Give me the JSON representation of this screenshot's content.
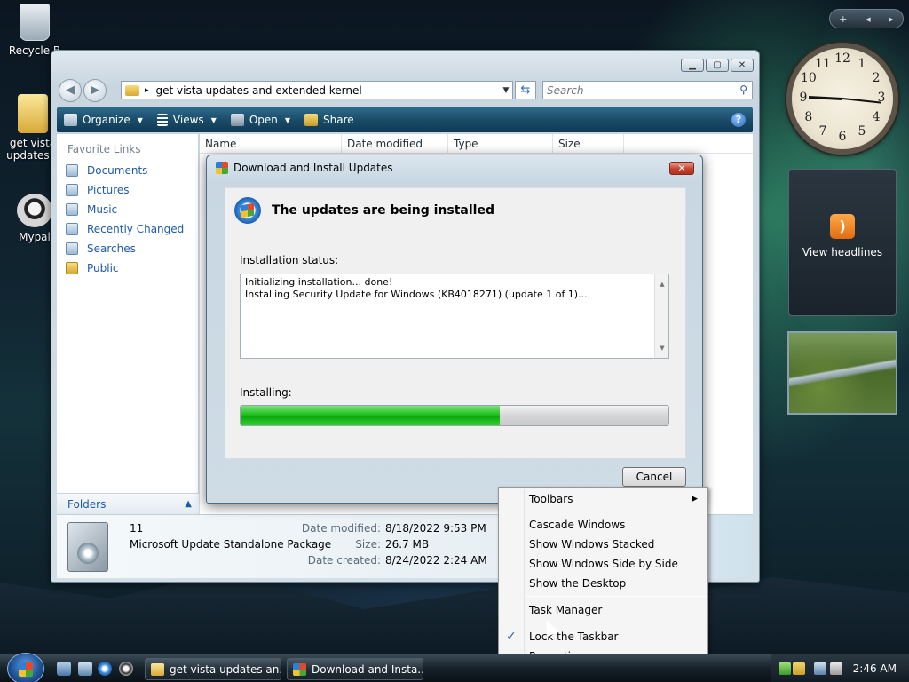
{
  "desktop": {
    "icons": [
      {
        "label": "Recycle B",
        "glyph": "recycle-bin-icon"
      },
      {
        "label": "get vista updates a",
        "glyph": "folder-icon"
      },
      {
        "label": "Mypal",
        "glyph": "mypal-icon"
      }
    ]
  },
  "gadgets": {
    "feed_label": "View headlines",
    "clock_numbers": [
      "12",
      "1",
      "2",
      "3",
      "4",
      "5",
      "6",
      "7",
      "8",
      "9",
      "10",
      "11"
    ]
  },
  "explorer": {
    "address": "get vista updates and extended kernel",
    "search_placeholder": "Search",
    "commands": [
      {
        "label": "Organize",
        "dropdown": true
      },
      {
        "label": "Views",
        "dropdown": true
      },
      {
        "label": "Open",
        "dropdown": true
      },
      {
        "label": "Share",
        "dropdown": false
      }
    ],
    "favorite_links_header": "Favorite Links",
    "favorite_links": [
      "Documents",
      "Pictures",
      "Music",
      "Recently Changed",
      "Searches",
      "Public"
    ],
    "folders_label": "Folders",
    "columns": [
      "Name",
      "Date modified",
      "Type",
      "Size"
    ],
    "details": {
      "name": "11",
      "type": "Microsoft Update Standalone Package",
      "date_modified_label": "Date modified:",
      "date_modified": "8/18/2022 9:53 PM",
      "size_label": "Size:",
      "size": "26.7 MB",
      "date_created_label": "Date created:",
      "date_created": "8/24/2022 2:24 AM"
    }
  },
  "dialog": {
    "title": "Download and Install Updates",
    "heading": "The updates are being installed",
    "status_label": "Installation status:",
    "log_lines": [
      "Initializing installation... done!",
      "Installing Security Update for Windows (KB4018271) (update 1 of 1)..."
    ],
    "installing_label": "Installing:",
    "progress_fraction": 0.605,
    "cancel_label": "Cancel"
  },
  "context_menu": {
    "items": [
      {
        "label": "Toolbars",
        "submenu": true
      },
      {
        "label": "Cascade Windows"
      },
      {
        "label": "Show Windows Stacked"
      },
      {
        "label": "Show Windows Side by Side"
      },
      {
        "label": "Show the Desktop"
      },
      {
        "label": "Task Manager"
      },
      {
        "label": "Lock the Taskbar",
        "checked": true
      },
      {
        "label": "Properties"
      }
    ]
  },
  "taskbar": {
    "tasks": [
      {
        "label": "get vista updates an..."
      },
      {
        "label": "Download and Insta..."
      }
    ],
    "time": "2:46 AM"
  },
  "colors": {
    "link": "#1f5aa8",
    "progress": "#20c020",
    "cmdbar": "#184a66"
  }
}
